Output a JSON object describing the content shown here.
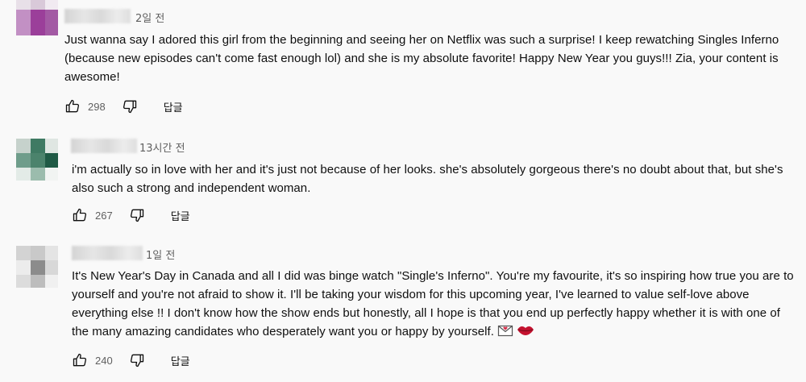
{
  "comments": [
    {
      "time": "2일 전",
      "text": "Just wanna say I adored this girl from the beginning and seeing her on Netflix was such a surprise! I keep rewatching Singles Inferno (because new episodes can't come fast enough lol) and she is my absolute favorite! Happy New Year you guys!!! Zia, your content is awesome!",
      "likes": "298",
      "reply_label": "답글"
    },
    {
      "time": "13시간 전",
      "text": "i'm actually so in love with her and it's just not because of her looks. she's absolutely gorgeous there's no doubt about that, but she's also such a strong and independent woman.",
      "likes": "267",
      "reply_label": "답글"
    },
    {
      "time": "1일 전",
      "text": "It's New Year's Day in Canada and all I did was binge watch \"Single's Inferno\". You're my favourite, it's so inspiring how true you are to yourself and you're not afraid to show it. I'll be taking your wisdom for this upcoming year, I've learned to value self-love above everything else !! I don't know how the show ends but honestly, all I hope is that you end up perfectly happy whether it is with one of the many amazing candidates who desperately want you or happy by yourself.",
      "likes": "240",
      "reply_label": "답글"
    }
  ],
  "icons": {
    "like": "thumbs-up-icon",
    "dislike": "thumbs-down-icon",
    "emoji1": "love-letter-icon",
    "emoji2": "kiss-lips-icon"
  },
  "colors": {
    "background": "#f9f9f9",
    "text": "#0f0f0f",
    "meta": "#606060"
  }
}
